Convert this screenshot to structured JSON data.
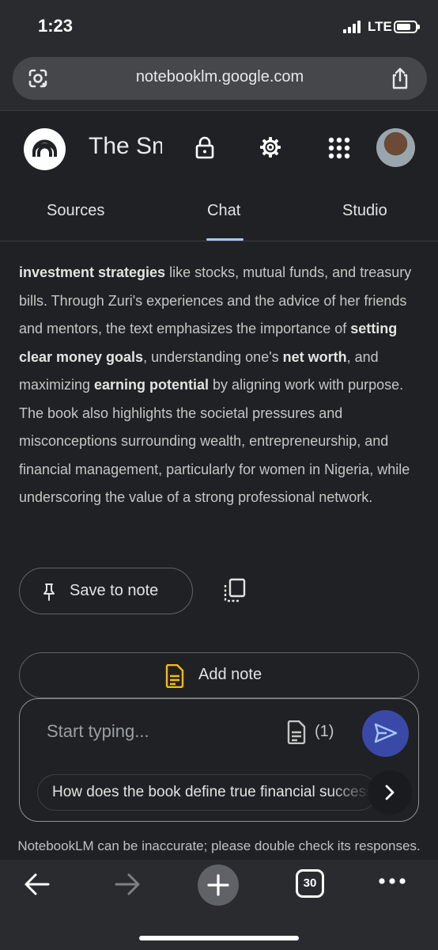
{
  "status_bar": {
    "time": "1:23",
    "network": "LTE",
    "battery_level": 0.75
  },
  "browser": {
    "url": "notebooklm.google.com",
    "lens_icon": "google-lens-icon",
    "share_icon": "share-icon"
  },
  "header": {
    "notebook_title": "The Sm",
    "logo_icon": "notebooklm-logo",
    "icons": [
      "lock-icon",
      "gear-icon",
      "apps-grid-icon"
    ],
    "avatar": "user-avatar"
  },
  "tabs": [
    {
      "label": "Sources"
    },
    {
      "label": "Chat"
    },
    {
      "label": "Studio"
    }
  ],
  "active_tab": "Chat",
  "answer": {
    "p1": "investment strategies",
    "p2": " like stocks, mutual funds, and treasury bills. Through Zuri's experiences and the advice of her friends and mentors, the text emphasizes the importance of ",
    "p3": "setting clear money goals",
    "p4": ", understanding one's ",
    "p5": "net worth",
    "p6": ", and maximizing ",
    "p7": "earning potential",
    "p8": " by aligning work with purpose. The book also highlights the societal pressures and misconceptions surrounding wealth, entrepreneurship, and financial management, particularly for women in Nigeria, while underscoring the value of a strong professional network."
  },
  "actions": {
    "save_to_note": "Save to note",
    "add_note": "Add note"
  },
  "composer": {
    "placeholder": "Start typing...",
    "source_count": "(1)",
    "suggestion": "How does the book define true financial success?"
  },
  "disclaimer": "NotebookLM can be inaccurate; please double check its responses.",
  "toolbar": {
    "tab_count": "30"
  },
  "colors": {
    "background": "#202124",
    "tab_indicator": "#a8c7fa",
    "send_button": "#3a48a8",
    "note_icon": "#fbbc04"
  }
}
